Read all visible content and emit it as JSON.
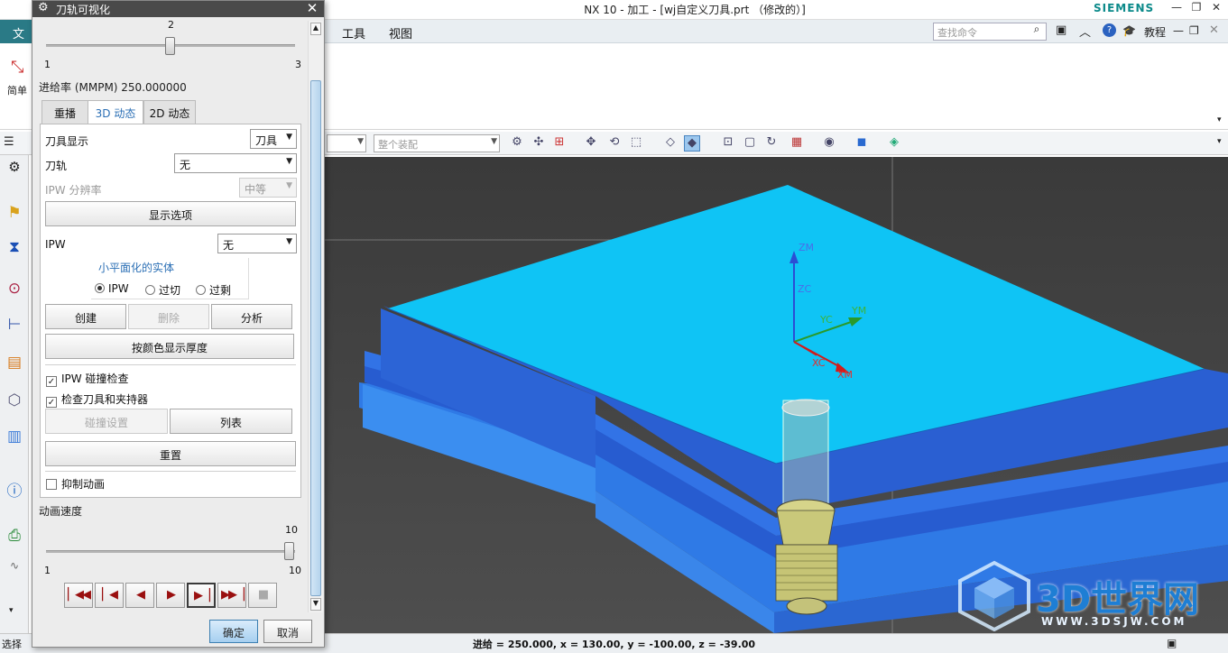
{
  "window": {
    "app_logo": "NX",
    "title": "NX 10 - 加工 - [wj自定义刀具.prt （修改的）]",
    "brand": "SIEMENS",
    "min_icon": "minimize-icon",
    "restore_icon": "restore-icon",
    "close_icon": "close-icon"
  },
  "menubar": {
    "file_partial": "文",
    "tools": "工具",
    "view": "视图",
    "search_placeholder": "查找命令",
    "tutorial": "教程"
  },
  "ribbon": {
    "simple_partial": "简单"
  },
  "toolbar2": {
    "assembly_combo": "整个装配"
  },
  "dialog": {
    "title": "刀轨可视化",
    "slider_top": {
      "current_label": "2",
      "min_label": "1",
      "max_label": "3",
      "value": 2,
      "min": 1,
      "max": 3
    },
    "feed_rate": "进给率 (MMPM) 250.000000",
    "tabs": [
      "重播",
      "3D 动态",
      "2D 动态"
    ],
    "active_tab": 1,
    "tool_display_label": "刀具显示",
    "tool_display_value": "刀具",
    "toolpath_label": "刀轨",
    "toolpath_value": "无",
    "ipw_resolution_label": "IPW 分辨率",
    "ipw_resolution_value": "中等",
    "display_options_button": "显示选项",
    "ipw_label": "IPW",
    "ipw_value": "无",
    "faceted_solid_title": "小平面化的实体",
    "radios": [
      {
        "label": "IPW",
        "checked": true
      },
      {
        "label": "过切",
        "checked": false
      },
      {
        "label": "过剩",
        "checked": false
      }
    ],
    "create_button": "创建",
    "delete_button": "删除",
    "analyze_button": "分析",
    "thickness_button": "按颜色显示厚度",
    "ipw_collision_check": "IPW 碰撞检查",
    "check_tool_holder": "检查刀具和夹持器",
    "collision_settings_button": "碰撞设置",
    "list_button": "列表",
    "reset_button": "重置",
    "suppress_animation": "抑制动画",
    "anim_speed_label": "动画速度",
    "slider_speed": {
      "current_label": "10",
      "min_label": "1",
      "max_label": "10",
      "value": 10,
      "min": 1,
      "max": 10
    },
    "ok_button": "确定",
    "cancel_button": "取消"
  },
  "viewport": {
    "axes": {
      "zm": "ZM",
      "zc": "ZC",
      "yc": "YC",
      "ym": "YM",
      "xc": "XC",
      "xm": "XM"
    },
    "watermark_text": "3D世界网",
    "watermark_url": "WWW.3DSJW.COM"
  },
  "statusbar": {
    "select_label": "选择",
    "text": "进给 = 250.000, x = 130.00, y = -100.00, z = -39.00"
  },
  "colors": {
    "part_top": "#0fc4f5",
    "part_side": "#2f62d8",
    "viewport_bg": "#444444",
    "dialog_bg": "#ececec"
  }
}
